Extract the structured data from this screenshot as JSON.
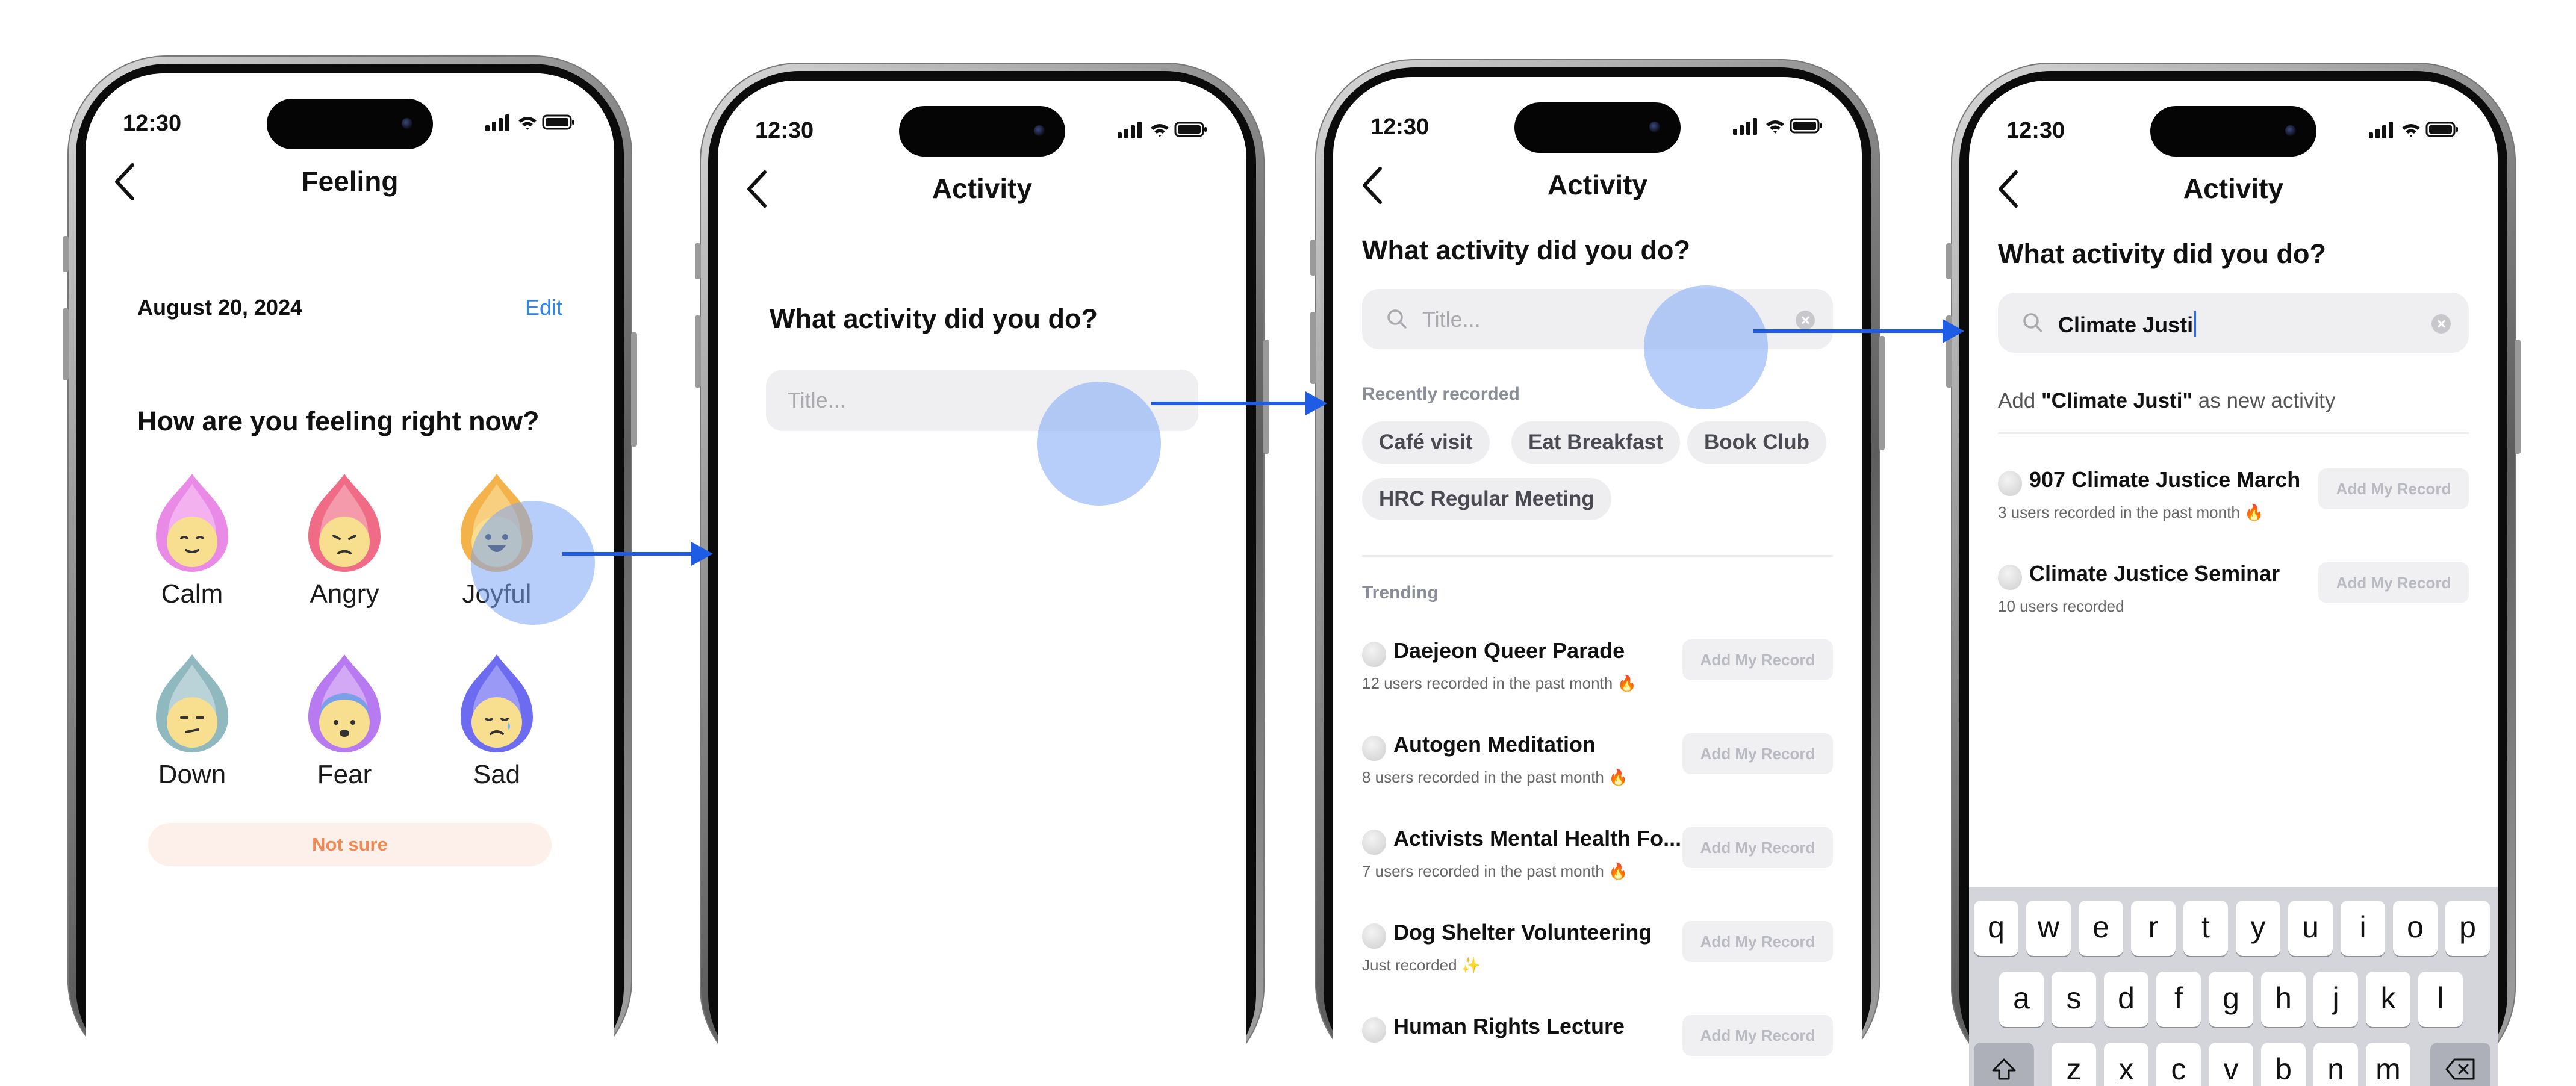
{
  "status": {
    "time": "12:30"
  },
  "screen1": {
    "title": "Feeling",
    "date": "August 20, 2024",
    "edit_label": "Edit",
    "question": "How are you feeling right now?",
    "emotions": [
      {
        "label": "Calm",
        "color": "#e98be6"
      },
      {
        "label": "Angry",
        "color": "#ef6b86"
      },
      {
        "label": "Joyful",
        "color": "#f4b24a"
      },
      {
        "label": "Down",
        "color": "#8fb8bf"
      },
      {
        "label": "Fear",
        "color": "#b77af0"
      },
      {
        "label": "Sad",
        "color": "#6d6cf0"
      }
    ],
    "not_sure_label": "Not sure"
  },
  "screen2": {
    "title": "Activity",
    "question": "What activity did you do?",
    "placeholder": "Title..."
  },
  "screen3": {
    "title": "Activity",
    "question": "What activity did you do?",
    "placeholder": "Title...",
    "recent_heading": "Recently recorded",
    "recent_chips": [
      "Café visit",
      "Eat Breakfast",
      "Book Club",
      "HRC Regular Meeting"
    ],
    "trending_heading": "Trending",
    "trending": [
      {
        "name": "Daejeon Queer Parade",
        "meta": "12 users recorded in the past month 🔥"
      },
      {
        "name": "Autogen Meditation",
        "meta": "8 users recorded in the past month 🔥"
      },
      {
        "name": "Activists Mental Health Fo...",
        "meta": "7 users recorded in the past month 🔥"
      },
      {
        "name": "Dog Shelter Volunteering",
        "meta": "Just recorded ✨"
      },
      {
        "name": "Human Rights Lecture",
        "meta": ""
      }
    ],
    "add_label": "Add My Record"
  },
  "screen4": {
    "title": "Activity",
    "question": "What activity did you do?",
    "search_value": "Climate Justi",
    "add_prefix": "Add ",
    "add_term": "\"Climate Justi\"",
    "add_suffix": " as new activity",
    "results": [
      {
        "name": "907 Climate Justice March",
        "meta": "3 users recorded in the past month 🔥"
      },
      {
        "name": "Climate Justice Seminar",
        "meta": "10 users recorded"
      }
    ],
    "add_label": "Add My Record",
    "keyboard": {
      "row1": [
        "q",
        "w",
        "e",
        "r",
        "t",
        "y",
        "u",
        "i",
        "o",
        "p"
      ],
      "row2": [
        "a",
        "s",
        "d",
        "f",
        "g",
        "h",
        "j",
        "k",
        "l"
      ],
      "row3": [
        "z",
        "x",
        "c",
        "v",
        "b",
        "n",
        "m"
      ]
    }
  },
  "colors": {
    "accent": "#1f5ce6",
    "touch": "#7ea6f5",
    "link": "#2f86e8",
    "not_sure": "#f08a55"
  }
}
